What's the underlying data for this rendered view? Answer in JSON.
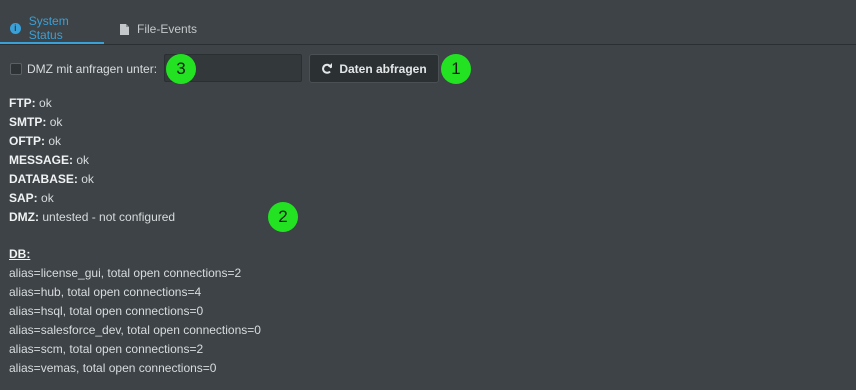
{
  "tabs": [
    {
      "label": "System Status",
      "icon": "info-icon",
      "active": true
    },
    {
      "label": "File-Events",
      "icon": "file-icon",
      "active": false
    }
  ],
  "controls": {
    "checkbox_label": "DMZ mit anfragen unter:",
    "checkbox_checked": false,
    "input_value": "",
    "button_label": "Daten abfragen",
    "button_icon": "refresh-icon"
  },
  "markers": [
    "1",
    "2",
    "3"
  ],
  "status": [
    {
      "key": "FTP:",
      "value": "ok"
    },
    {
      "key": "SMTP:",
      "value": "ok"
    },
    {
      "key": "OFTP:",
      "value": "ok"
    },
    {
      "key": "MESSAGE:",
      "value": "ok"
    },
    {
      "key": "DATABASE:",
      "value": "ok"
    },
    {
      "key": "SAP:",
      "value": "ok"
    },
    {
      "key": "DMZ:",
      "value": "untested - not configured"
    }
  ],
  "db": {
    "title": "DB:",
    "lines": [
      "alias=license_gui, total open connections=2",
      "alias=hub, total open connections=4",
      "alias=hsql, total open connections=0",
      "alias=salesforce_dev, total open connections=0",
      "alias=scm, total open connections=2",
      "alias=vemas, total open connections=0"
    ]
  },
  "colors": {
    "accent": "#3aa0d8",
    "background": "#3d4346",
    "marker": "#22e222"
  }
}
